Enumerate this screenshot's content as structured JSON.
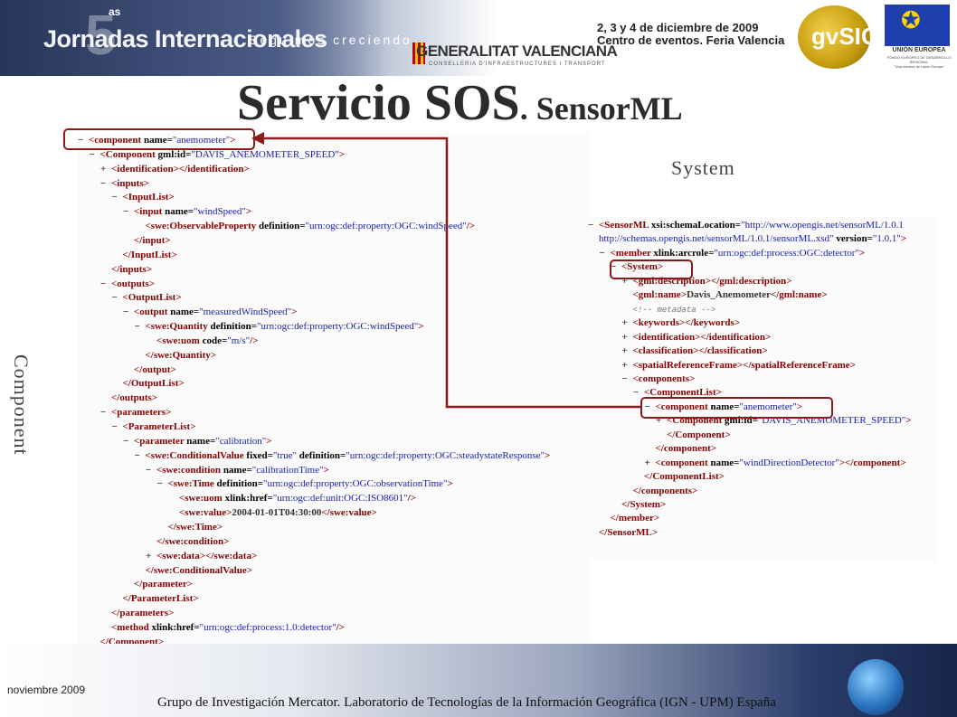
{
  "banner": {
    "logo_number": "5",
    "logo_super": "as",
    "logo_text": "Jornadas Internacionales",
    "logo_slogan": "Seguimos creciendo",
    "sponsor": "GENERALITAT VALENCIANA",
    "sponsor_sub": "CONSELLERIA D'INFRAESTRUCTURES I TRANSPORT",
    "dates_line1": "2, 3 y 4 de diciembre de 2009",
    "dates_line2": "Centro de eventos. Feria Valencia",
    "gvsig": "gvSIG",
    "eu_label": "UNIÓN EUROPEA",
    "eu_sub": "FONDO EUROPEO DE DESARROLLO REGIONAL",
    "eu_motto": "\"Una manera de hacer Europa\""
  },
  "title": {
    "main": "Servicio SOS",
    "sub": ". SensorML"
  },
  "labels": {
    "system": "System",
    "component": "Component"
  },
  "left_xml": [
    {
      "indent": 0,
      "marker": "−",
      "parts": [
        [
          "t",
          "<component "
        ],
        [
          "a",
          "name="
        ],
        [
          "v",
          "\"anemometer\""
        ],
        [
          "t",
          ">"
        ]
      ]
    },
    {
      "indent": 1,
      "marker": "−",
      "parts": [
        [
          "t",
          "<Component "
        ],
        [
          "a",
          "gml:id="
        ],
        [
          "v",
          "\"DAVIS_ANEMOMETER_SPEED\""
        ],
        [
          "t",
          ">"
        ]
      ]
    },
    {
      "indent": 2,
      "marker": "+",
      "parts": [
        [
          "t",
          "<identification></identification>"
        ]
      ]
    },
    {
      "indent": 2,
      "marker": "−",
      "parts": [
        [
          "t",
          "<inputs>"
        ]
      ]
    },
    {
      "indent": 3,
      "marker": "−",
      "parts": [
        [
          "t",
          "<InputList>"
        ]
      ]
    },
    {
      "indent": 4,
      "marker": "−",
      "parts": [
        [
          "t",
          "<input "
        ],
        [
          "a",
          "name="
        ],
        [
          "v",
          "\"windSpeed\""
        ],
        [
          "t",
          ">"
        ]
      ]
    },
    {
      "indent": 5,
      "marker": "",
      "parts": [
        [
          "t",
          "<swe:ObservableProperty "
        ],
        [
          "a",
          "definition="
        ],
        [
          "v",
          "\"urn:ogc:def:property:OGC:windSpeed\""
        ],
        [
          "t",
          "/>"
        ]
      ]
    },
    {
      "indent": 4,
      "marker": "",
      "parts": [
        [
          "t",
          "</input>"
        ]
      ]
    },
    {
      "indent": 3,
      "marker": "",
      "parts": [
        [
          "t",
          "</InputList>"
        ]
      ]
    },
    {
      "indent": 2,
      "marker": "",
      "parts": [
        [
          "t",
          "</inputs>"
        ]
      ]
    },
    {
      "indent": 2,
      "marker": "−",
      "parts": [
        [
          "t",
          "<outputs>"
        ]
      ]
    },
    {
      "indent": 3,
      "marker": "−",
      "parts": [
        [
          "t",
          "<OutputList>"
        ]
      ]
    },
    {
      "indent": 4,
      "marker": "−",
      "parts": [
        [
          "t",
          "<output "
        ],
        [
          "a",
          "name="
        ],
        [
          "v",
          "\"measuredWindSpeed\""
        ],
        [
          "t",
          ">"
        ]
      ]
    },
    {
      "indent": 5,
      "marker": "−",
      "parts": [
        [
          "t",
          "<swe:Quantity "
        ],
        [
          "a",
          "definition="
        ],
        [
          "v",
          "\"urn:ogc:def:property:OGC:windSpeed\""
        ],
        [
          "t",
          ">"
        ]
      ]
    },
    {
      "indent": 6,
      "marker": "",
      "parts": [
        [
          "t",
          "<swe:uom "
        ],
        [
          "a",
          "code="
        ],
        [
          "v",
          "\"m/s\""
        ],
        [
          "t",
          "/>"
        ]
      ]
    },
    {
      "indent": 5,
      "marker": "",
      "parts": [
        [
          "t",
          "</swe:Quantity>"
        ]
      ]
    },
    {
      "indent": 4,
      "marker": "",
      "parts": [
        [
          "t",
          "</output>"
        ]
      ]
    },
    {
      "indent": 3,
      "marker": "",
      "parts": [
        [
          "t",
          "</OutputList>"
        ]
      ]
    },
    {
      "indent": 2,
      "marker": "",
      "parts": [
        [
          "t",
          "</outputs>"
        ]
      ]
    },
    {
      "indent": 2,
      "marker": "−",
      "parts": [
        [
          "t",
          "<parameters>"
        ]
      ]
    },
    {
      "indent": 3,
      "marker": "−",
      "parts": [
        [
          "t",
          "<ParameterList>"
        ]
      ]
    },
    {
      "indent": 4,
      "marker": "−",
      "parts": [
        [
          "t",
          "<parameter "
        ],
        [
          "a",
          "name="
        ],
        [
          "v",
          "\"calibration\""
        ],
        [
          "t",
          ">"
        ]
      ]
    },
    {
      "indent": 5,
      "marker": "−",
      "parts": [
        [
          "t",
          "<swe:ConditionalValue "
        ],
        [
          "a",
          "fixed="
        ],
        [
          "v",
          "\"true\""
        ],
        [
          "a",
          " definition="
        ],
        [
          "v",
          "\"urn:ogc:def:property:OGC:steadystateResponse\""
        ],
        [
          "t",
          ">"
        ]
      ]
    },
    {
      "indent": 6,
      "marker": "−",
      "parts": [
        [
          "t",
          "<swe:condition "
        ],
        [
          "a",
          "name="
        ],
        [
          "v",
          "\"calibrationTime\""
        ],
        [
          "t",
          ">"
        ]
      ]
    },
    {
      "indent": 7,
      "marker": "−",
      "parts": [
        [
          "t",
          "<swe:Time "
        ],
        [
          "a",
          "definition="
        ],
        [
          "v",
          "\"urn:ogc:def:property:OGC:observationTime\""
        ],
        [
          "t",
          ">"
        ]
      ]
    },
    {
      "indent": 8,
      "marker": "",
      "parts": [
        [
          "t",
          "<swe:uom "
        ],
        [
          "a",
          "xlink:href="
        ],
        [
          "v",
          "\"urn:ogc:def:unit:OGC:ISO8601\""
        ],
        [
          "t",
          "/>"
        ]
      ]
    },
    {
      "indent": 8,
      "marker": "",
      "parts": [
        [
          "t",
          "<swe:value>"
        ],
        [
          "m",
          "2004-01-01T04:30:00"
        ],
        [
          "t",
          "</swe:value>"
        ]
      ]
    },
    {
      "indent": 7,
      "marker": "",
      "parts": [
        [
          "t",
          "</swe:Time>"
        ]
      ]
    },
    {
      "indent": 6,
      "marker": "",
      "parts": [
        [
          "t",
          "</swe:condition>"
        ]
      ]
    },
    {
      "indent": 6,
      "marker": "+",
      "parts": [
        [
          "t",
          "<swe:data></swe:data>"
        ]
      ]
    },
    {
      "indent": 5,
      "marker": "",
      "parts": [
        [
          "t",
          "</swe:ConditionalValue>"
        ]
      ]
    },
    {
      "indent": 4,
      "marker": "",
      "parts": [
        [
          "t",
          "</parameter>"
        ]
      ]
    },
    {
      "indent": 3,
      "marker": "",
      "parts": [
        [
          "t",
          "</ParameterList>"
        ]
      ]
    },
    {
      "indent": 2,
      "marker": "",
      "parts": [
        [
          "t",
          "</parameters>"
        ]
      ]
    },
    {
      "indent": 2,
      "marker": "",
      "parts": [
        [
          "t",
          "<method "
        ],
        [
          "a",
          "xlink:href="
        ],
        [
          "v",
          "\"urn:ogc:def:process:1.0:detector\""
        ],
        [
          "t",
          "/>"
        ]
      ]
    },
    {
      "indent": 1,
      "marker": "",
      "parts": [
        [
          "t",
          "</Component>"
        ]
      ]
    }
  ],
  "right_xml": [
    {
      "indent": 0,
      "marker": "−",
      "parts": [
        [
          "t",
          "<SensorML "
        ],
        [
          "a",
          "xsi:schemaLocation="
        ],
        [
          "v",
          "\"http://www.opengis.net/sensorML/1.0.1"
        ]
      ]
    },
    {
      "indent": 0,
      "marker": "",
      "parts": [
        [
          "v",
          "http://schemas.opengis.net/sensorML/1.0.1/sensorML.xsd\""
        ],
        [
          "a",
          " version="
        ],
        [
          "v",
          "\"1.0.1\""
        ],
        [
          "t",
          ">"
        ]
      ]
    },
    {
      "indent": 1,
      "marker": "−",
      "parts": [
        [
          "t",
          "<member "
        ],
        [
          "a",
          "xlink:arcrole="
        ],
        [
          "v",
          "\"urn:ogc:def:process:OGC:detector\""
        ],
        [
          "t",
          ">"
        ]
      ]
    },
    {
      "indent": 2,
      "marker": "−",
      "parts": [
        [
          "t",
          "<System>"
        ]
      ]
    },
    {
      "indent": 3,
      "marker": "+",
      "parts": [
        [
          "t",
          "<gml:description></gml:description>"
        ]
      ]
    },
    {
      "indent": 3,
      "marker": "",
      "parts": [
        [
          "t",
          "<gml:name>"
        ],
        [
          "m",
          "Davis_Anemometer"
        ],
        [
          "t",
          "</gml:name>"
        ]
      ]
    },
    {
      "indent": 3,
      "marker": "",
      "parts": [
        [
          "c",
          "<!-- metadata -->"
        ]
      ]
    },
    {
      "indent": 3,
      "marker": "+",
      "parts": [
        [
          "t",
          "<keywords></keywords>"
        ]
      ]
    },
    {
      "indent": 3,
      "marker": "+",
      "parts": [
        [
          "t",
          "<identification></identification>"
        ]
      ]
    },
    {
      "indent": 3,
      "marker": "+",
      "parts": [
        [
          "t",
          "<classification></classification>"
        ]
      ]
    },
    {
      "indent": 3,
      "marker": "+",
      "parts": [
        [
          "t",
          "<spatialReferenceFrame></spatialReferenceFrame>"
        ]
      ]
    },
    {
      "indent": 3,
      "marker": "−",
      "parts": [
        [
          "t",
          "<components>"
        ]
      ]
    },
    {
      "indent": 4,
      "marker": "−",
      "parts": [
        [
          "t",
          "<ComponentList>"
        ]
      ]
    },
    {
      "indent": 5,
      "marker": "−",
      "parts": [
        [
          "t",
          "<component "
        ],
        [
          "a",
          "name="
        ],
        [
          "v",
          "\"anemometer\""
        ],
        [
          "t",
          ">"
        ]
      ]
    },
    {
      "indent": 6,
      "marker": "+",
      "parts": [
        [
          "t",
          "<Component "
        ],
        [
          "a",
          "gml:id="
        ],
        [
          "v",
          "\"DAVIS_ANEMOMETER_SPEED\""
        ],
        [
          "t",
          ">"
        ]
      ]
    },
    {
      "indent": 6,
      "marker": "",
      "parts": [
        [
          "t",
          "</Component>"
        ]
      ]
    },
    {
      "indent": 5,
      "marker": "",
      "parts": [
        [
          "t",
          "</component>"
        ]
      ]
    },
    {
      "indent": 5,
      "marker": "+",
      "parts": [
        [
          "t",
          "<component "
        ],
        [
          "a",
          "name="
        ],
        [
          "v",
          "\"windDirectionDetector\""
        ],
        [
          "t",
          "></component>"
        ]
      ]
    },
    {
      "indent": 4,
      "marker": "",
      "parts": [
        [
          "t",
          "</ComponentList>"
        ]
      ]
    },
    {
      "indent": 3,
      "marker": "",
      "parts": [
        [
          "t",
          "</components>"
        ]
      ]
    },
    {
      "indent": 2,
      "marker": "",
      "parts": [
        [
          "t",
          "</System>"
        ]
      ]
    },
    {
      "indent": 1,
      "marker": "",
      "parts": [
        [
          "t",
          "</member>"
        ]
      ]
    },
    {
      "indent": 0,
      "marker": "",
      "parts": [
        [
          "t",
          "</SensorML>"
        ]
      ]
    }
  ],
  "footer": {
    "date": "noviembre 2009",
    "text": "Grupo de Investigación Mercator. Laboratorio de Tecnologías de la Información Geográfica (IGN - UPM) España"
  },
  "colors": {
    "highlight": "#8b1a1a",
    "tag": "#880000",
    "value": "#1a1ab0"
  }
}
